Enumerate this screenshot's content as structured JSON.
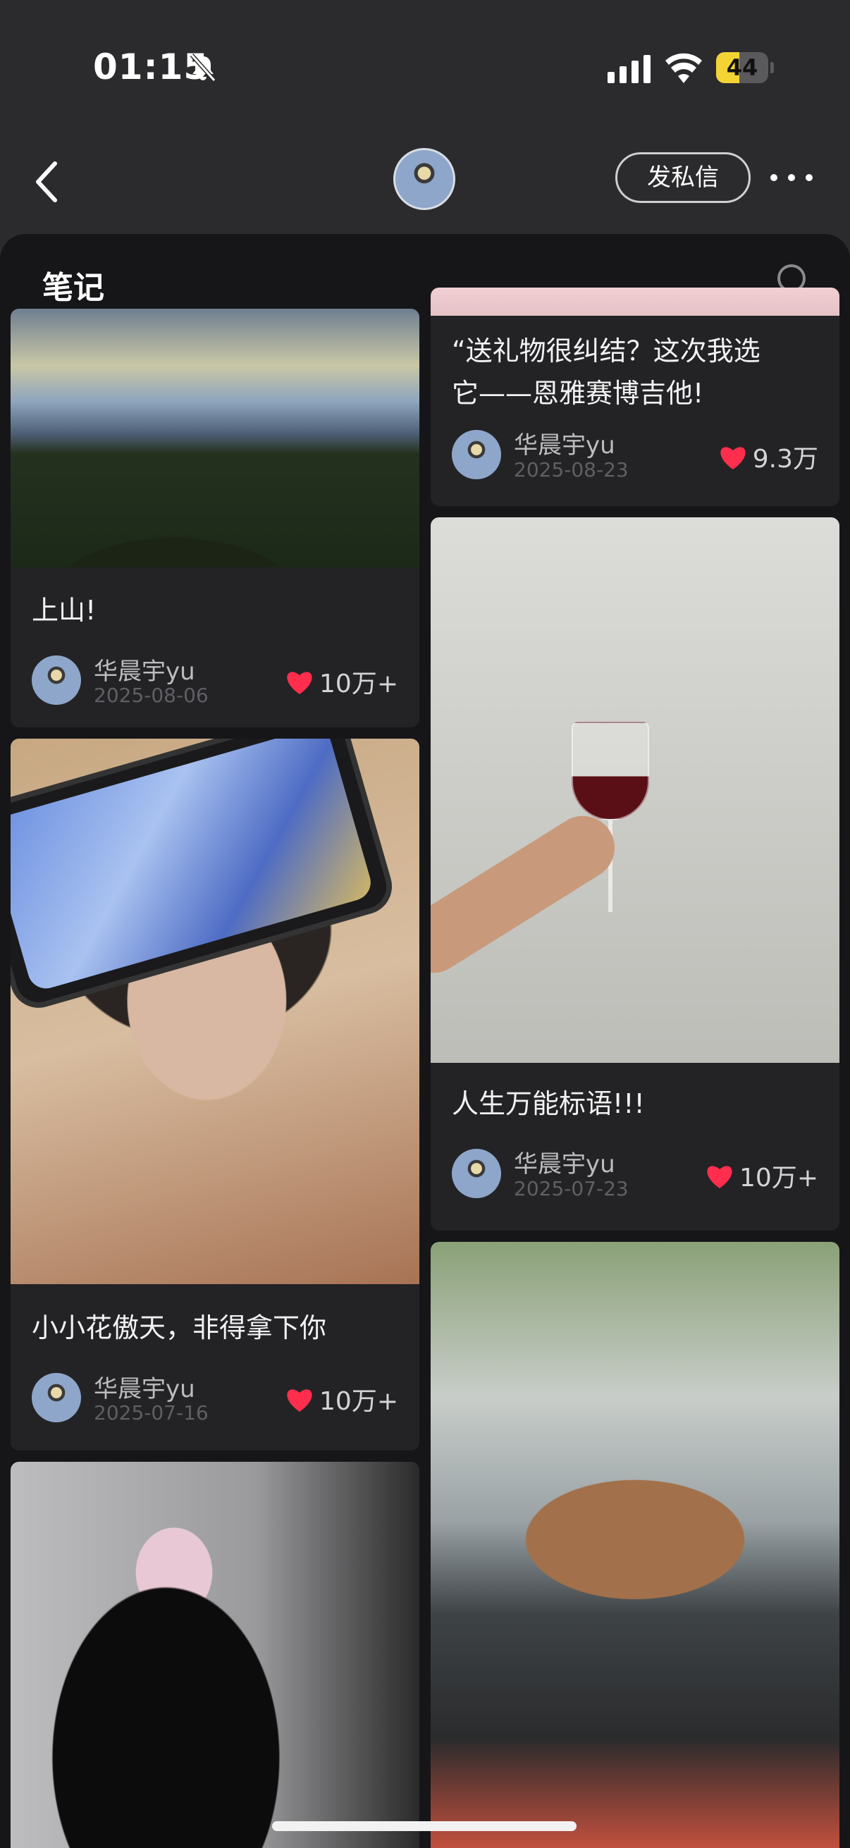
{
  "status_bar": {
    "time": "01:15",
    "battery_level": "44",
    "battery_fraction": 0.44,
    "icons": [
      "bell-off-icon",
      "signal-icon",
      "wifi-icon",
      "battery-icon"
    ]
  },
  "header": {
    "back_icon": "chevron-left-icon",
    "dm_button_label": "发私信",
    "more_icon": "more-dots-icon"
  },
  "sheet": {
    "title": "笔记",
    "search_icon": "search-icon"
  },
  "notes": {
    "left": [
      {
        "title": "上山!",
        "author": "华晨宇yu",
        "date": "2025-08-06",
        "likes": "10万+"
      },
      {
        "title": "小小花傲天，非得拿下你",
        "author": "华晨宇yu",
        "date": "2025-07-16",
        "likes": "10万+"
      },
      {
        "title": "",
        "author": "",
        "date": "",
        "likes": ""
      }
    ],
    "right": [
      {
        "title_line1": "“送礼物很纠结？这次我选",
        "title_line2": "它——恩雅赛博吉他!",
        "author": "华晨宇yu",
        "date": "2025-08-23",
        "likes": "9.3万"
      },
      {
        "title": "人生万能标语!!!",
        "author": "华晨宇yu",
        "date": "2025-07-23",
        "likes": "10万+"
      },
      {
        "title": "",
        "author": "",
        "date": "",
        "likes": ""
      }
    ]
  },
  "colors": {
    "background": "#2b2b2d",
    "sheet": "#161619",
    "card": "#232326",
    "heart": "#ff2e4d",
    "battery": "#f4d335"
  }
}
